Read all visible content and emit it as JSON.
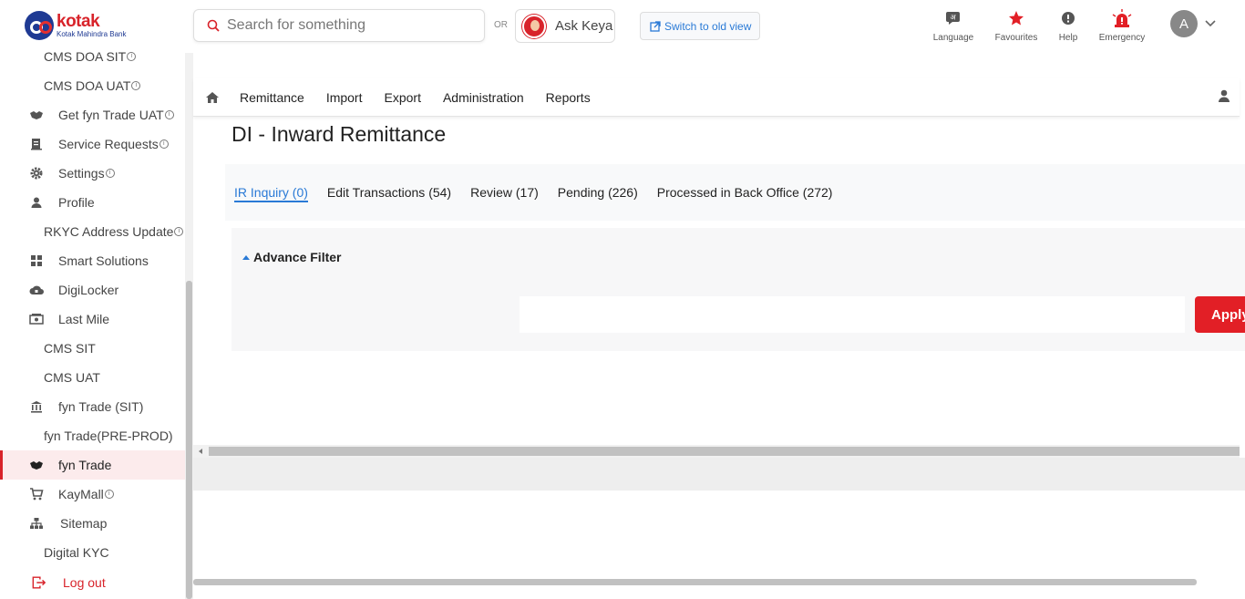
{
  "brand": {
    "name": "kotak",
    "sub": "Kotak Mahindra Bank"
  },
  "search": {
    "placeholder": "Search for something"
  },
  "or_label": "OR",
  "keya_label": "Ask Keya",
  "switch_label": "Switch to old view",
  "tools": [
    {
      "label": "Language",
      "icon": "language-icon"
    },
    {
      "label": "Favourites",
      "icon": "star-icon"
    },
    {
      "label": "Help",
      "icon": "help-icon"
    },
    {
      "label": "Emergency",
      "icon": "siren-icon"
    }
  ],
  "user_initial": "A",
  "sidebar": {
    "items": [
      {
        "label": "CMS DOA SIT",
        "icon": null,
        "info": true
      },
      {
        "label": "CMS DOA UAT",
        "icon": null,
        "info": true
      },
      {
        "label": "Get fyn Trade UAT",
        "icon": "handshake-icon",
        "info": true
      },
      {
        "label": "Service Requests",
        "icon": "document-icon",
        "info": true
      },
      {
        "label": "Settings",
        "icon": "gear-icon",
        "info": true
      },
      {
        "label": "Profile",
        "icon": "person-icon",
        "info": false
      },
      {
        "label": "RKYC Address Update",
        "icon": null,
        "info": true
      },
      {
        "label": "Smart Solutions",
        "icon": "grid-icon",
        "info": false
      },
      {
        "label": "DigiLocker",
        "icon": "cloud-icon",
        "info": false
      },
      {
        "label": "Last Mile",
        "icon": "cash-icon",
        "info": false
      },
      {
        "label": "CMS SIT",
        "icon": null,
        "info": false
      },
      {
        "label": "CMS UAT",
        "icon": null,
        "info": false
      },
      {
        "label": "fyn Trade (SIT)",
        "icon": "bank-icon",
        "info": false
      },
      {
        "label": "fyn Trade(PRE-PROD)",
        "icon": null,
        "info": false
      },
      {
        "label": "fyn Trade",
        "icon": "handshake-icon",
        "info": false,
        "active": true
      },
      {
        "label": "KayMall",
        "icon": "cart-icon",
        "info": true
      },
      {
        "label": "Sitemap",
        "icon": "sitemap-icon",
        "info": false
      },
      {
        "label": "Digital KYC",
        "icon": null,
        "info": false
      },
      {
        "label": "Log out",
        "icon": "logout-icon",
        "info": false
      }
    ]
  },
  "nav": {
    "items": [
      "Remittance",
      "Import",
      "Export",
      "Administration",
      "Reports"
    ]
  },
  "page_title": "DI - Inward Remittance",
  "tabs": [
    {
      "label": "IR Inquiry (0)",
      "active": true
    },
    {
      "label": "Edit Transactions (54)"
    },
    {
      "label": "Review (17)"
    },
    {
      "label": "Pending (226)"
    },
    {
      "label": "Processed in Back Office (272)"
    }
  ],
  "filter": {
    "title": "Advance Filter",
    "apply_label": "Apply"
  },
  "colors": {
    "brand_red": "#d8232a",
    "link_blue": "#2a7ad6",
    "brand_navy": "#1f3a93"
  }
}
